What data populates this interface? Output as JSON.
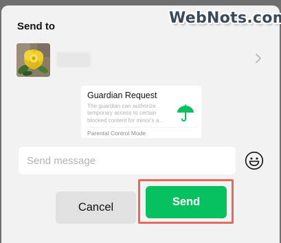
{
  "watermark": {
    "text": "WebNots.com"
  },
  "dialog": {
    "title": "Send to",
    "recipient": {
      "avatar_icon": "yellow-rose-photo",
      "name_hidden": true,
      "chevron_icon": "chevron-right-icon"
    },
    "shared_card": {
      "title": "Guardian Request",
      "description": "The guardian can authorize temporary access to certain blocked content for minor's a...",
      "icon": "umbrella-icon",
      "icon_color": "#07c160",
      "footer": "Parental Control Mode"
    },
    "message": {
      "placeholder": "Send message",
      "value": "",
      "emoji_icon": "smiley-face-icon"
    },
    "actions": {
      "cancel_label": "Cancel",
      "send_label": "Send",
      "send_color": "#07c160",
      "highlight_color": "#e5685e"
    }
  }
}
